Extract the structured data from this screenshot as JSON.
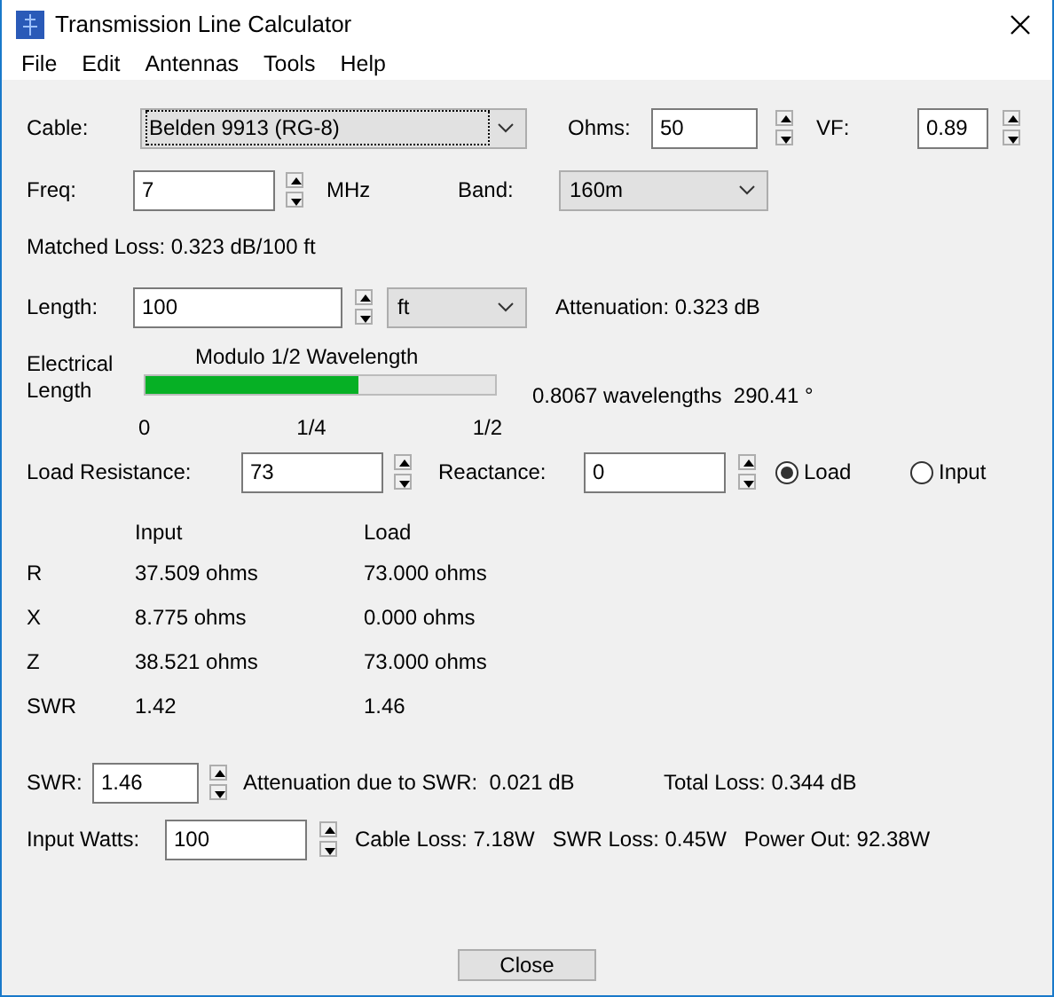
{
  "window": {
    "title": "Transmission Line Calculator"
  },
  "menu": [
    "File",
    "Edit",
    "Antennas",
    "Tools",
    "Help"
  ],
  "cable": {
    "label": "Cable:",
    "value": "Belden 9913 (RG-8)"
  },
  "ohms": {
    "label": "Ohms:",
    "value": "50"
  },
  "vf": {
    "label": "VF:",
    "value": "0.89"
  },
  "freq": {
    "label": "Freq:",
    "value": "7",
    "unit": "MHz"
  },
  "band": {
    "label": "Band:",
    "value": "160m"
  },
  "matched_loss": "Matched Loss: 0.323 dB/100 ft",
  "length": {
    "label": "Length:",
    "value": "100",
    "unit": "ft",
    "attenuation": "Attenuation: 0.323 dB"
  },
  "electrical_length": {
    "label": "Electrical Length",
    "caption": "Modulo 1/2 Wavelength",
    "level": 0.61,
    "ticks": [
      "0",
      "1/4",
      "1/2"
    ],
    "reading": "0.8067 wavelengths  290.41 °"
  },
  "load_resistance": {
    "label": "Load Resistance:",
    "value": "73"
  },
  "reactance": {
    "label": "Reactance:",
    "value": "0"
  },
  "radios": [
    {
      "label": "Load",
      "selected": true
    },
    {
      "label": "Input",
      "selected": false
    }
  ],
  "results": {
    "columns": [
      "Input",
      "Load"
    ],
    "rows": [
      {
        "name": "R",
        "input": "37.509 ohms",
        "load": "73.000 ohms"
      },
      {
        "name": "X",
        "input": "8.775 ohms",
        "load": "0.000 ohms"
      },
      {
        "name": "Z",
        "input": "38.521 ohms",
        "load": "73.000 ohms"
      },
      {
        "name": "SWR",
        "input": "1.42",
        "load": "1.46"
      }
    ]
  },
  "swr": {
    "label": "SWR:",
    "value": "1.46",
    "attenuation": "Attenuation due to SWR:  0.021 dB",
    "total_loss": "Total Loss: 0.344 dB"
  },
  "input_watts": {
    "label": "Input Watts:",
    "value": "100",
    "cable_loss": "Cable Loss: 7.18W",
    "swr_loss": "SWR Loss: 0.45W",
    "power_out": "Power Out: 92.38W"
  },
  "buttons": [
    "Close"
  ]
}
